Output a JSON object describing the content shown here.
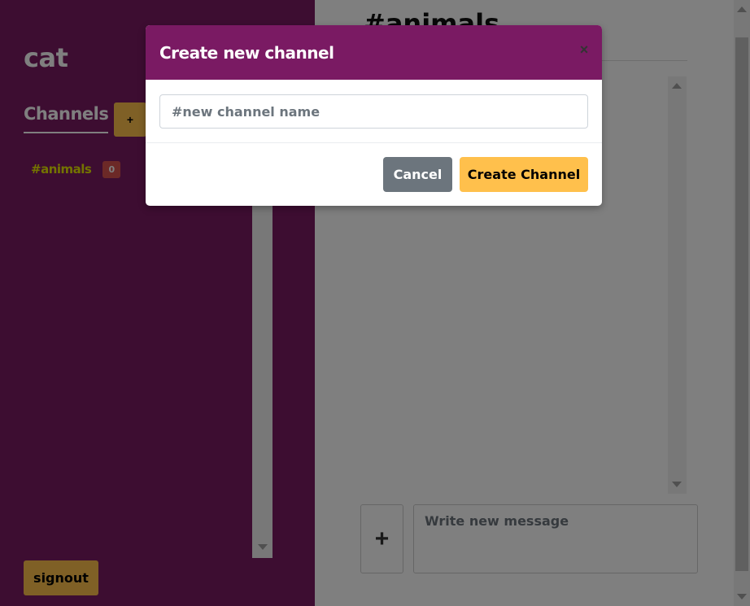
{
  "sidebar": {
    "username": "cat",
    "channels_title": "Channels",
    "add_channel_label": "+",
    "channels": [
      {
        "name": "#animals",
        "unread": "0"
      }
    ],
    "signout_label": "signout"
  },
  "main": {
    "channel_title": "#animals",
    "attach_label": "+",
    "message_placeholder": "Write new message"
  },
  "modal": {
    "title": "Create new channel",
    "close_label": "×",
    "input_placeholder": "#new channel name",
    "cancel_label": "Cancel",
    "create_label": "Create Channel"
  },
  "colors": {
    "sidebar_bg": "#7a1a63",
    "accent": "#ffc04c",
    "channel_text": "#e6e600",
    "badge": "#d9534f",
    "cancel": "#6c757d"
  }
}
